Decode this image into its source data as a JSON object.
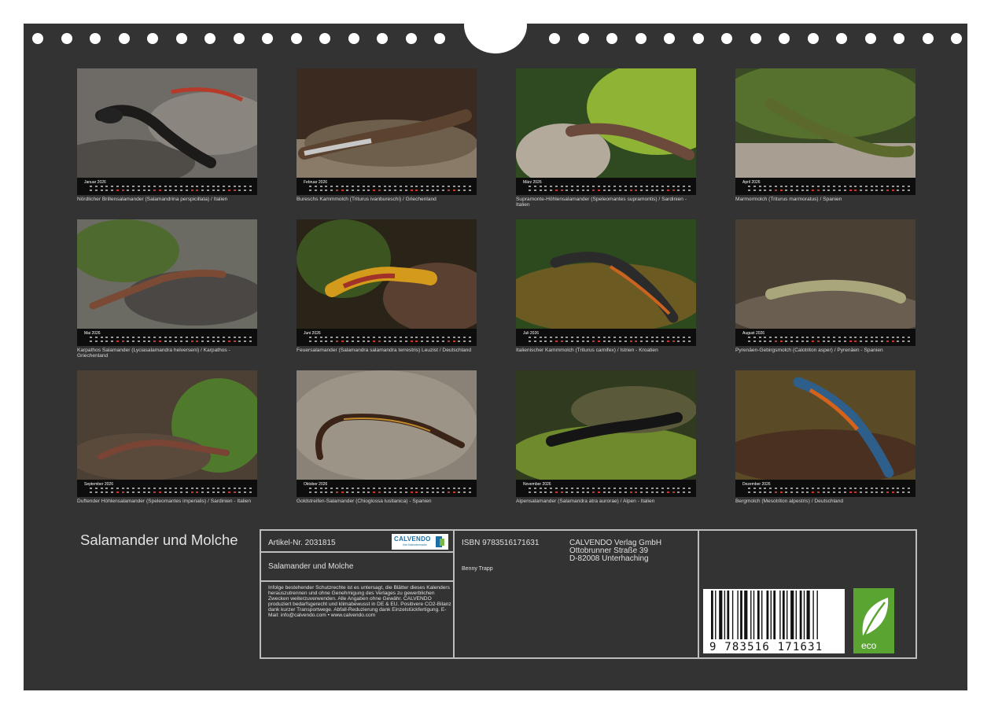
{
  "calendar": {
    "title": "Salamander und Molche",
    "months": [
      {
        "month": "Januar 2026",
        "caption": "Nördlicher Brillensalamander (Salamandrina perspicillata) / Italien"
      },
      {
        "month": "Februar 2026",
        "caption": "Bureschs Kammmolch (Triturus ivanbureschi) / Griechenland"
      },
      {
        "month": "März 2026",
        "caption": "Supramonte-Höhlensalamander (Speleomantes supramontis) / Sardinien - Italien"
      },
      {
        "month": "April 2026",
        "caption": "Marmormolch (Triturus marmoratus) / Spanien"
      },
      {
        "month": "Mai 2026",
        "caption": "Karpathos Salamander (Lyciasalamandra helverseni) / Karpathos - Griechenland"
      },
      {
        "month": "Juni 2026",
        "caption": "Feuersalamander (Salamandra salamandra terrestris) Leuzist / Deutschland"
      },
      {
        "month": "Juli 2026",
        "caption": "Italienischer Kammmolch (Triturus carnifex) / Istrien - Kroatien"
      },
      {
        "month": "August 2026",
        "caption": "Pyrenäen-Gebirgsmolch (Calotriton asper) / Pyrenäen - Spanien"
      },
      {
        "month": "September 2026",
        "caption": "Duftender Höhlensalamander (Speleomantes imperialis) / Sardinien - Italien"
      },
      {
        "month": "Oktober 2026",
        "caption": "Goldstreifen-Salamander (Chioglossa lusitanica) - Spanien"
      },
      {
        "month": "November 2026",
        "caption": "Alpensalamander (Salamandra atra aurorae) / Alpen - Italien"
      },
      {
        "month": "Dezember 2026",
        "caption": "Bergmolch (Mesotriton alpestris) / Deutschland"
      }
    ]
  },
  "info": {
    "artikel": "Artikel-Nr. 2031815",
    "logo_text": "CALVENDO",
    "logo_sub": "Ihre Kalendermarke",
    "subtitle": "Salamander und Molche",
    "isbn": "ISBN 9783516171631",
    "author": "Benny Trapp",
    "publisher_name": "CALVENDO Verlag GmbH",
    "publisher_street": "Ottobrunner Straße 39",
    "publisher_city": "D-82008 Unterhaching",
    "legal": "Infolge bestehender Schutzrechte ist es untersagt, die Blätter dieses Kalenders herauszutrennen und ohne Genehmigung des Verlages zu gewerblichen Zwecken weiterzuverwenden. Alle Angaben ohne Gewähr. CALVENDO produziert bedarfsgerecht und klimabewusst in DE & EU. Positivere CO2-Bilanz dank kurzer Transportwege. Abfall-Reduzierung dank Einzelstückfertigung. E-Mail: info@calvendo.com • www.calvendo.com",
    "barcode_digits": "9 783516 171631",
    "eco_label": "eco"
  },
  "colors": {
    "background": "#333333",
    "eco_green": "#5aa531",
    "brand_blue": "#1d6fa3"
  }
}
